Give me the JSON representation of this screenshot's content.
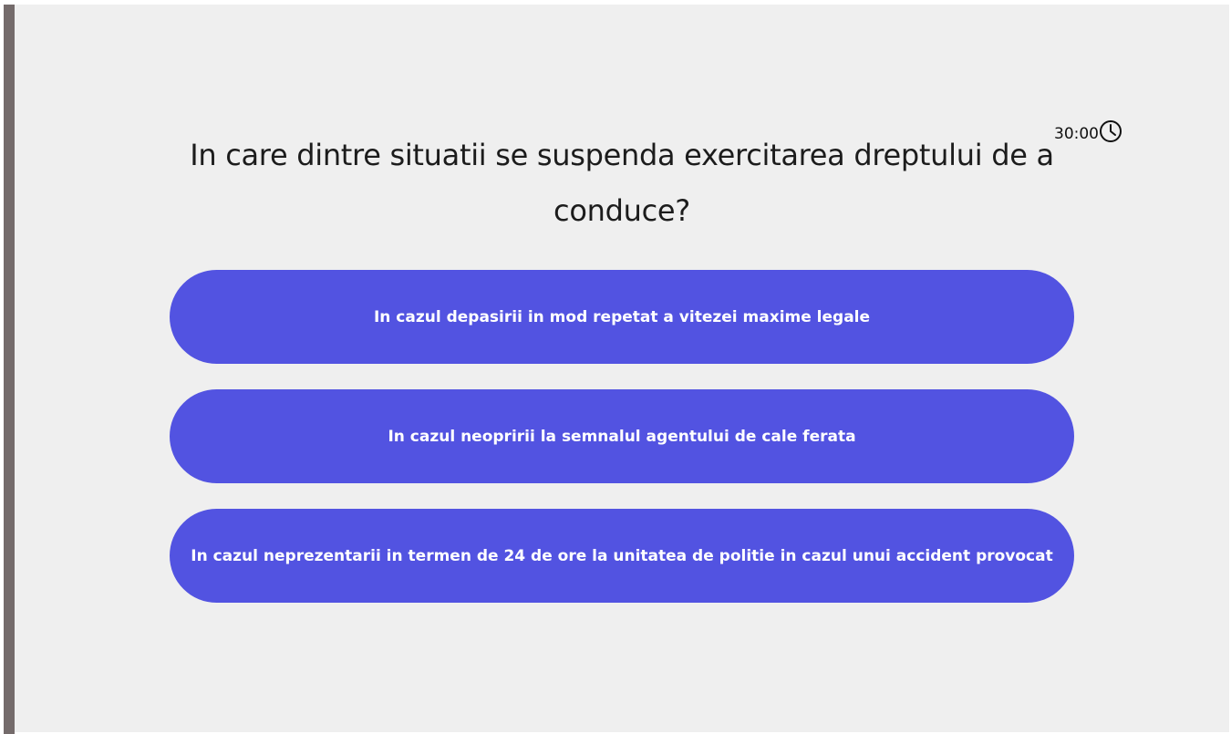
{
  "timer": {
    "value": "30:00",
    "icon": "clock-icon"
  },
  "question": {
    "text": "In care dintre situatii se suspenda exercitarea dreptului de a conduce?"
  },
  "answers": [
    {
      "label": "In cazul depasirii in mod repetat a vitezei maxime legale"
    },
    {
      "label": "In cazul neopririi la semnalul agentului de cale ferata"
    },
    {
      "label": "In cazul neprezentarii in termen de 24 de ore la unitatea de politie in cazul unui accident provocat"
    }
  ],
  "colors": {
    "answer_background": "#5253e1",
    "panel_background": "#efefef",
    "left_bar": "#746b6b",
    "answer_text": "#ffffff"
  }
}
